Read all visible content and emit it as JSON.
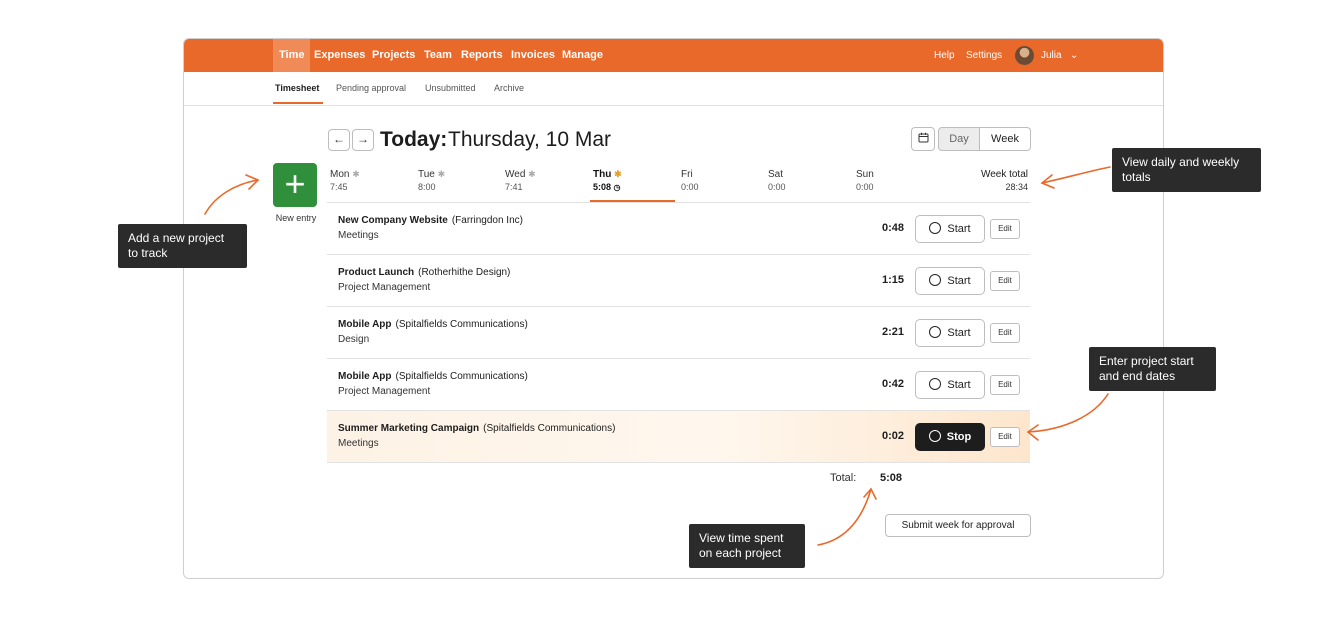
{
  "colors": {
    "brand": "#e8692a",
    "primary_action": "#2f8f3b",
    "dark": "#1d1d1d"
  },
  "topnav": {
    "items": [
      "Time",
      "Expenses",
      "Projects",
      "Team",
      "Reports",
      "Invoices",
      "Manage"
    ],
    "right": {
      "help": "Help",
      "settings": "Settings",
      "user": "Julia"
    }
  },
  "subnav": {
    "items": [
      "Timesheet",
      "Pending approval",
      "Unsubmitted",
      "Archive"
    ]
  },
  "header": {
    "prev": "←",
    "next": "→",
    "title_bold": "Today:",
    "title_date": "Thursday, 10 Mar",
    "view_day": "Day",
    "view_week": "Week"
  },
  "new_entry": {
    "plus": "+",
    "label": "New entry"
  },
  "days": [
    {
      "name": "Mon",
      "value": "7:45"
    },
    {
      "name": "Tue",
      "value": "8:00"
    },
    {
      "name": "Wed",
      "value": "7:41"
    },
    {
      "name": "Thu",
      "value": "5:08"
    },
    {
      "name": "Fri",
      "value": "0:00"
    },
    {
      "name": "Sat",
      "value": "0:00"
    },
    {
      "name": "Sun",
      "value": "0:00"
    }
  ],
  "week_total": {
    "label": "Week total",
    "value": "28:34"
  },
  "entries": [
    {
      "project": "New Company Website",
      "client": "(Farringdon Inc)",
      "task": "Meetings",
      "duration": "0:48",
      "action": "Start",
      "edit": "Edit"
    },
    {
      "project": "Product Launch",
      "client": "(Rotherhithe Design)",
      "task": "Project Management",
      "duration": "1:15",
      "action": "Start",
      "edit": "Edit"
    },
    {
      "project": "Mobile App",
      "client": "(Spitalfields Communications)",
      "task": "Design",
      "duration": "2:21",
      "action": "Start",
      "edit": "Edit"
    },
    {
      "project": "Mobile App",
      "client": "(Spitalfields Communications)",
      "task": "Project Management",
      "duration": "0:42",
      "action": "Start",
      "edit": "Edit"
    },
    {
      "project": "Summer Marketing Campaign",
      "client": "(Spitalfields Communications)",
      "task": "Meetings",
      "duration": "0:02",
      "action": "Stop",
      "edit": "Edit"
    }
  ],
  "footer": {
    "total_label": "Total:",
    "total_value": "5:08",
    "submit": "Submit week for approval"
  },
  "callouts": {
    "new_project": [
      "Add a new project",
      "to track"
    ],
    "totals": [
      "View daily and weekly",
      "totals"
    ],
    "dates": [
      "Enter project start",
      "and end dates"
    ],
    "time_spent": [
      "View time spent",
      "on each project"
    ]
  }
}
